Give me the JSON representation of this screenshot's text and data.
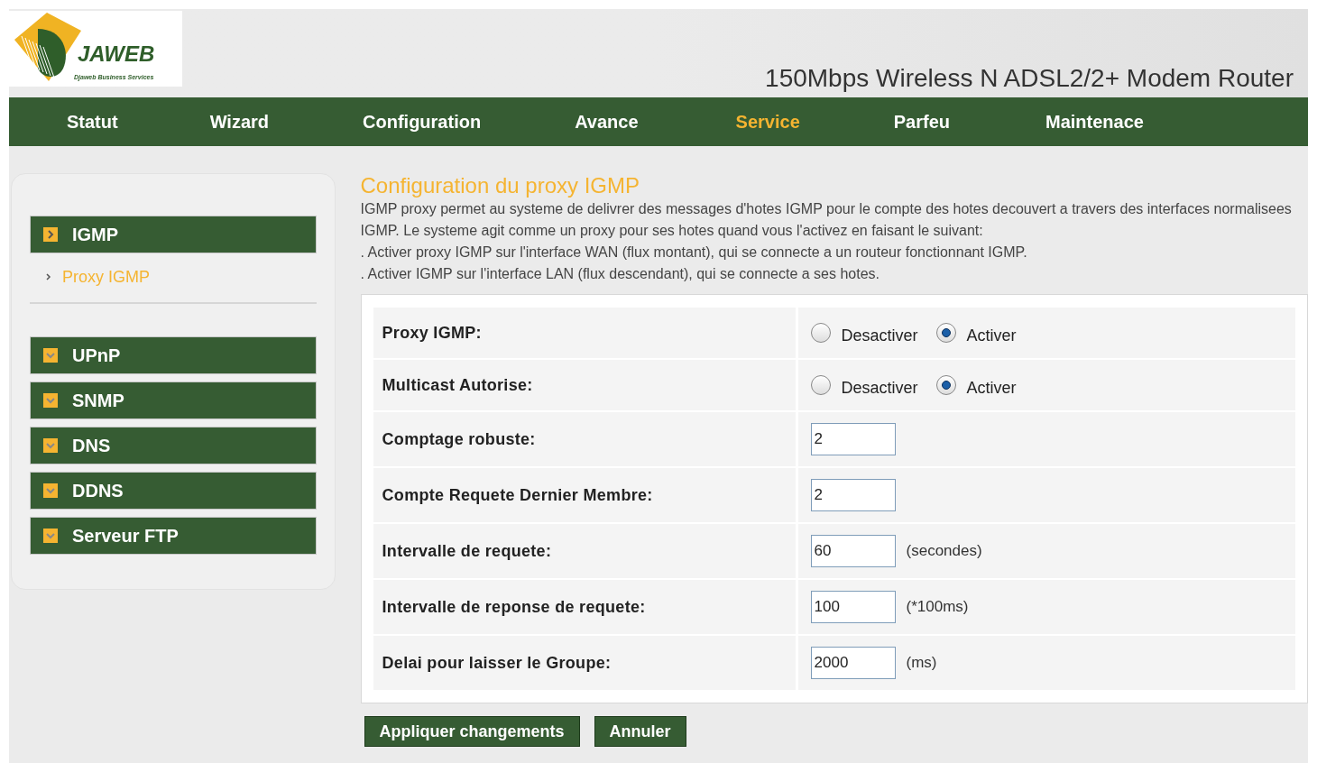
{
  "logo": {
    "name": "JAWEB",
    "tagline": "Djaweb Business Services"
  },
  "header": {
    "title": "150Mbps Wireless N ADSL2/2+ Modem Router"
  },
  "nav": [
    {
      "label": "Statut",
      "selected": false
    },
    {
      "label": "Wizard",
      "selected": false
    },
    {
      "label": "Configuration",
      "selected": false
    },
    {
      "label": "Avance",
      "selected": false
    },
    {
      "label": "Service",
      "selected": true
    },
    {
      "label": "Parfeu",
      "selected": false
    },
    {
      "label": "Maintenace",
      "selected": false
    }
  ],
  "sidebar": {
    "groups": [
      {
        "label": "IGMP",
        "expanded": true,
        "children": [
          {
            "label": "Proxy IGMP",
            "selected": true
          }
        ]
      },
      {
        "label": "UPnP",
        "expanded": false
      },
      {
        "label": "SNMP",
        "expanded": false
      },
      {
        "label": "DNS",
        "expanded": false
      },
      {
        "label": "DDNS",
        "expanded": false
      },
      {
        "label": "Serveur FTP",
        "expanded": false
      }
    ]
  },
  "content": {
    "title": "Configuration du proxy IGMP",
    "description": [
      "IGMP proxy permet au systeme de delivrer des messages d'hotes IGMP pour le compte des hotes decouvert a travers des interfaces normalisees IGMP. Le systeme agit comme un proxy pour ses hotes quand vous l'activez en faisant le suivant:",
      ". Activer proxy IGMP sur l'interface WAN (flux montant), qui se connecte a un routeur fonctionnant IGMP.",
      ". Activer IGMP sur l'interface LAN (flux descendant), qui se connecte a ses hotes."
    ],
    "rows": [
      {
        "kind": "radio",
        "label": "Proxy IGMP:",
        "options": [
          {
            "label": "Desactiver",
            "selected": false
          },
          {
            "label": "Activer",
            "selected": true
          }
        ]
      },
      {
        "kind": "radio",
        "label": "Multicast Autorise:",
        "options": [
          {
            "label": "Desactiver",
            "selected": false
          },
          {
            "label": "Activer",
            "selected": true
          }
        ]
      },
      {
        "kind": "text",
        "label": "Comptage robuste:",
        "value": "2"
      },
      {
        "kind": "text",
        "label": "Compte Requete Dernier Membre:",
        "value": "2"
      },
      {
        "kind": "text",
        "label": "Intervalle de requete:",
        "value": "60",
        "unit": "(secondes)"
      },
      {
        "kind": "text",
        "label": "Intervalle de reponse de requete:",
        "value": "100",
        "unit": "(*100ms)"
      },
      {
        "kind": "text",
        "label": "Delai pour laisser le Groupe:",
        "value": "2000",
        "unit": "(ms)"
      }
    ],
    "buttons": [
      "Appliquer changements",
      "Annuler"
    ]
  }
}
